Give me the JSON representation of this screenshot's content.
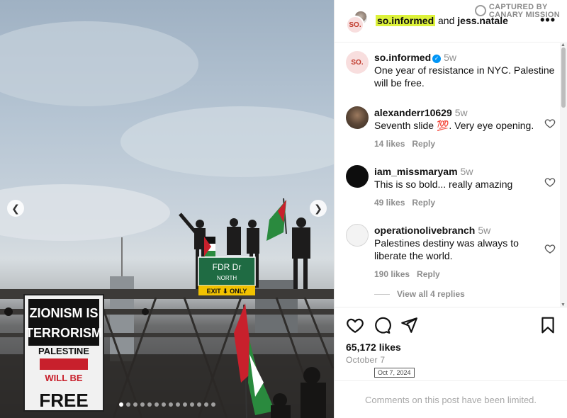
{
  "post": {
    "carousel": {
      "dot_count": 14,
      "active_index": 0
    },
    "photo_sign_text": {
      "protest_sign": [
        "ZIONISM IS",
        "TERRORISM"
      ],
      "protest_sign_sub": "PALESTINE",
      "protest_sign_bottom": [
        "WILL BE",
        "FREE"
      ],
      "street_sign": "FDR Dr",
      "street_sign_sub": "NORTH",
      "exit_sign": "EXIT ⬇ ONLY"
    }
  },
  "header": {
    "author": "so.informed",
    "and_text": "and",
    "collaborator": "jess.natale",
    "watermark_line1": "CAPTURED BY",
    "watermark_line2": "CANARY MISSION",
    "avatar_initials": "SO."
  },
  "caption": {
    "username": "so.informed",
    "time": "5w",
    "text": "One year of resistance in NYC. Palestine will be free."
  },
  "comments": [
    {
      "username": "alexanderr10629",
      "time": "5w",
      "text": "Seventh slide 💯. Very eye opening.",
      "likes": "14 likes",
      "reply": "Reply"
    },
    {
      "username": "iam_missmaryam",
      "time": "5w",
      "text": "This is so bold... really amazing",
      "likes": "49 likes",
      "reply": "Reply"
    },
    {
      "username": "operationolivebranch",
      "time": "5w",
      "text": "Palestines destiny was always to liberate the world.",
      "likes": "190 likes",
      "reply": "Reply"
    }
  ],
  "view_replies": "View all 4 replies",
  "stats": {
    "likes": "65,172 likes",
    "date": "October 7",
    "date_tooltip": "Oct 7, 2024"
  },
  "footer": {
    "limited_text": "Comments on this post have been limited."
  },
  "colors": {
    "highlight": "#ddf23a",
    "verified": "#0095f6",
    "muted": "#8e8e8e"
  }
}
